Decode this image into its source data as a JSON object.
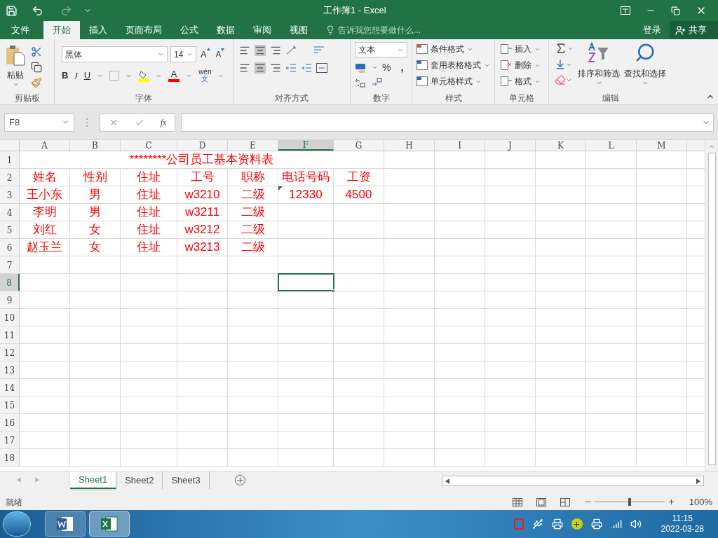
{
  "window": {
    "title": "工作簿1 - Excel"
  },
  "ribbon_tabs": [
    {
      "label": "文件",
      "selected": false
    },
    {
      "label": "开始",
      "selected": true
    },
    {
      "label": "插入",
      "selected": false
    },
    {
      "label": "页面布局",
      "selected": false
    },
    {
      "label": "公式",
      "selected": false
    },
    {
      "label": "数据",
      "selected": false
    },
    {
      "label": "审阅",
      "selected": false
    },
    {
      "label": "视图",
      "selected": false
    }
  ],
  "tell_me": {
    "placeholder": "告诉我您想要做什么..."
  },
  "account": {
    "sign_in": "登录",
    "share": "共享"
  },
  "ribbon": {
    "clipboard": {
      "label": "剪贴板",
      "paste": "粘贴"
    },
    "font": {
      "label": "字体",
      "font_name": "黑体",
      "font_size": "14",
      "grow": "A",
      "shrink": "A",
      "bold": "B",
      "italic": "I",
      "underline": "U",
      "font_color": "A",
      "phonetic_top": "wén",
      "phonetic_bottom": "文"
    },
    "alignment": {
      "label": "对齐方式"
    },
    "number": {
      "label": "数字",
      "format": "文本",
      "percent": "%",
      "comma": ","
    },
    "styles": {
      "label": "样式",
      "items": [
        "条件格式",
        "套用表格格式",
        "单元格样式"
      ]
    },
    "cells": {
      "label": "单元格",
      "items": [
        "插入",
        "删除",
        "格式"
      ]
    },
    "editing": {
      "label": "编辑",
      "items": [
        "排序和筛选",
        "查找和选择"
      ]
    }
  },
  "formula_bar": {
    "name_box": "F8",
    "fx": "fx"
  },
  "sheet": {
    "columns": [
      {
        "label": "A",
        "selected": false
      },
      {
        "label": "B",
        "selected": false
      },
      {
        "label": "C",
        "selected": false
      },
      {
        "label": "D",
        "selected": false
      },
      {
        "label": "E",
        "selected": false
      },
      {
        "label": "F",
        "selected": true
      },
      {
        "label": "G",
        "selected": false
      },
      {
        "label": "H",
        "selected": false
      },
      {
        "label": "I",
        "selected": false
      },
      {
        "label": "J",
        "selected": false
      },
      {
        "label": "K",
        "selected": false
      },
      {
        "label": "L",
        "selected": false
      },
      {
        "label": "M",
        "selected": false
      }
    ],
    "rows": [
      {
        "label": "1",
        "selected": false,
        "merged_title": "********公司员工基本资料表"
      },
      {
        "label": "2",
        "selected": false,
        "cells": [
          {
            "text": "姓名",
            "flag": false
          },
          {
            "text": "性别",
            "flag": false
          },
          {
            "text": "住址",
            "flag": false
          },
          {
            "text": "工号",
            "flag": false
          },
          {
            "text": "职称",
            "flag": false
          },
          {
            "text": "电话号码",
            "flag": false
          },
          {
            "text": "工资",
            "flag": false
          }
        ]
      },
      {
        "label": "3",
        "selected": false,
        "cells": [
          {
            "text": "王小东",
            "flag": false
          },
          {
            "text": "男",
            "flag": false
          },
          {
            "text": "住址",
            "flag": false
          },
          {
            "text": "w3210",
            "flag": false
          },
          {
            "text": "二级",
            "flag": false
          },
          {
            "text": "12330",
            "flag": true
          },
          {
            "text": "4500",
            "flag": false
          }
        ]
      },
      {
        "label": "4",
        "selected": false,
        "cells": [
          {
            "text": "李明",
            "flag": false
          },
          {
            "text": "男",
            "flag": false
          },
          {
            "text": "住址",
            "flag": false
          },
          {
            "text": "w3211",
            "flag": false
          },
          {
            "text": "二级",
            "flag": false
          }
        ]
      },
      {
        "label": "5",
        "selected": false,
        "cells": [
          {
            "text": "刘红",
            "flag": false
          },
          {
            "text": "女",
            "flag": false
          },
          {
            "text": "住址",
            "flag": false
          },
          {
            "text": "w3212",
            "flag": false
          },
          {
            "text": "二级",
            "flag": false
          }
        ]
      },
      {
        "label": "6",
        "selected": false,
        "cells": [
          {
            "text": "赵玉兰",
            "flag": false
          },
          {
            "text": "女",
            "flag": false
          },
          {
            "text": "住址",
            "flag": false
          },
          {
            "text": "w3213",
            "flag": false
          },
          {
            "text": "二级",
            "flag": false
          }
        ]
      },
      {
        "label": "7",
        "selected": false
      },
      {
        "label": "8",
        "selected": true
      },
      {
        "label": "9",
        "selected": false
      },
      {
        "label": "10",
        "selected": false
      },
      {
        "label": "11",
        "selected": false
      },
      {
        "label": "12",
        "selected": false
      },
      {
        "label": "13",
        "selected": false
      },
      {
        "label": "14",
        "selected": false
      },
      {
        "label": "15",
        "selected": false
      },
      {
        "label": "16",
        "selected": false
      },
      {
        "label": "17",
        "selected": false
      },
      {
        "label": "18",
        "selected": false
      }
    ]
  },
  "sheet_tabs": [
    {
      "label": "Sheet1",
      "selected": true
    },
    {
      "label": "Sheet2",
      "selected": false
    },
    {
      "label": "Sheet3",
      "selected": false
    }
  ],
  "status_bar": {
    "status": "就绪",
    "zoom": "100%",
    "zoom_slider": {
      "level": 0.5
    }
  },
  "taskbar": {
    "time": "11:15",
    "date": "2022-03-28"
  }
}
